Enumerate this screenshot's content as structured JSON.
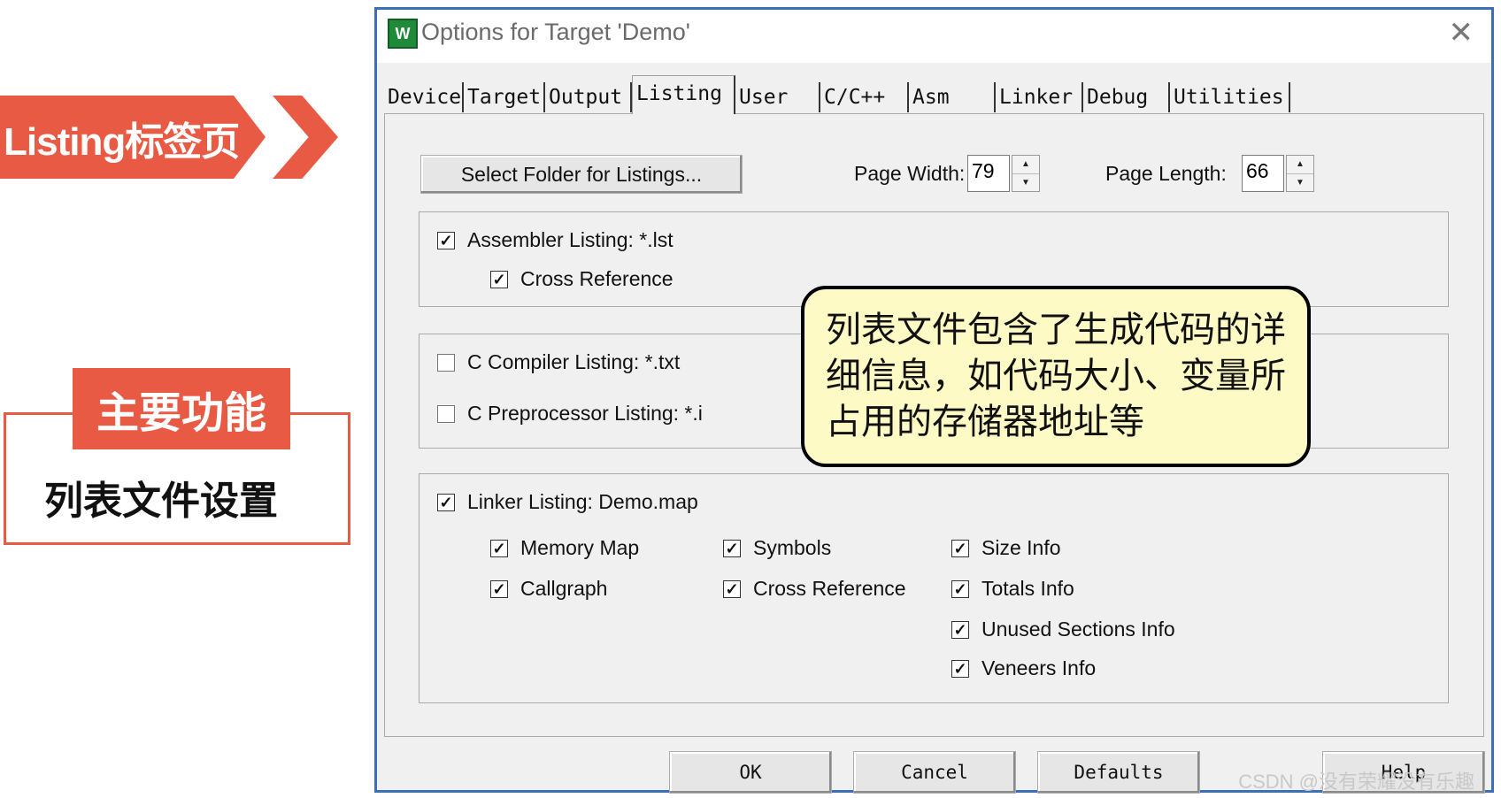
{
  "slide": {
    "banner_text": "Listing标签页",
    "function_tag": "主要功能",
    "function_desc": "列表文件设置",
    "callout_text": "列表文件包含了生成代码的详细信息，如代码大小、变量所占用的存储器地址等",
    "watermark": "CSDN @没有荣耀没有乐趣"
  },
  "dialog": {
    "title": "Options for Target 'Demo'",
    "icon_text": "W",
    "tabs": [
      "Device",
      "Target",
      "Output",
      "Listing",
      "User",
      "C/C++",
      "Asm",
      "Linker",
      "Debug",
      "Utilities"
    ],
    "active_tab": "Listing",
    "select_folder_label": "Select Folder for Listings...",
    "page_width_label": "Page Width:",
    "page_width_value": "79",
    "page_length_label": "Page Length:",
    "page_length_value": "66",
    "assembler": {
      "listing_label": "Assembler Listing:  *.lst",
      "listing_checked": true,
      "cross_ref_label": "Cross Reference",
      "cross_ref_checked": true
    },
    "compiler": {
      "c_listing_label": "C Compiler Listing:  *.txt",
      "c_listing_checked": false,
      "preprocessor_label": "C Preprocessor Listing:  *.i",
      "preprocessor_checked": false
    },
    "linker": {
      "listing_label": "Linker Listing:  Demo.map",
      "listing_checked": true,
      "options": [
        {
          "label": "Memory Map",
          "checked": true
        },
        {
          "label": "Callgraph",
          "checked": true
        },
        {
          "label": "Symbols",
          "checked": true
        },
        {
          "label": "Cross Reference",
          "checked": true
        },
        {
          "label": "Size Info",
          "checked": true
        },
        {
          "label": "Totals Info",
          "checked": true
        },
        {
          "label": "Unused Sections Info",
          "checked": true
        },
        {
          "label": "Veneers Info",
          "checked": true
        }
      ]
    },
    "buttons": {
      "ok": "OK",
      "cancel": "Cancel",
      "defaults": "Defaults",
      "help": "Help"
    }
  }
}
